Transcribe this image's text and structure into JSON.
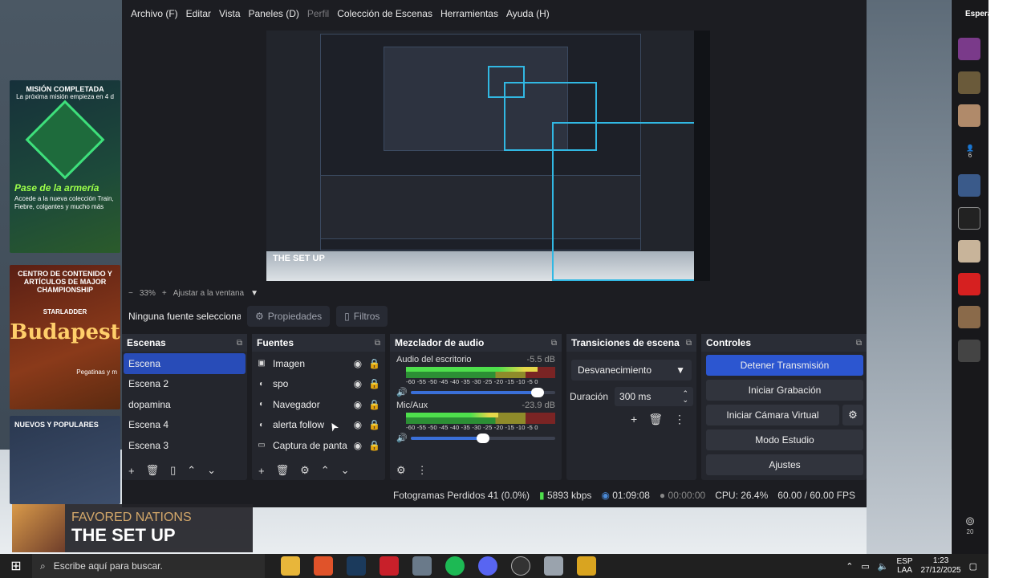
{
  "background": {
    "card1": {
      "title": "MISIÓN COMPLETADA",
      "subtitle": "La próxima misión empieza en 4 d",
      "headline": "Pase de la armería",
      "text": "Accede a la nueva colección Train, Fiebre, colgantes y mucho más"
    },
    "card2": {
      "title": "CENTRO DE CONTENIDO Y ARTÍCULOS DE MAJOR CHAMPIONSHIP",
      "brand": "STARLADDER",
      "headline": "Budapest",
      "note": "Pegatinas y m"
    },
    "card3": {
      "title": "NUEVOS Y POPULARES"
    }
  },
  "sidebar": {
    "title": "Espera",
    "viewers": "6",
    "podcast": "20"
  },
  "menu": [
    {
      "label": "Archivo (F)",
      "disabled": false
    },
    {
      "label": "Editar",
      "disabled": false
    },
    {
      "label": "Vista",
      "disabled": false
    },
    {
      "label": "Paneles (D)",
      "disabled": false
    },
    {
      "label": "Perfil",
      "disabled": true
    },
    {
      "label": "Colección de Escenas",
      "disabled": false
    },
    {
      "label": "Herramientas",
      "disabled": false
    },
    {
      "label": "Ayuda (H)",
      "disabled": false
    }
  ],
  "preview": {
    "inner_song": "THE SET UP"
  },
  "zoom": {
    "minus": "−",
    "level": "33%",
    "plus": "+",
    "fit_label": "Ajustar a la ventana",
    "arrow": "▼"
  },
  "source_toolbar": {
    "no_source": "Ninguna fuente seleccionac",
    "properties": "Propiedades",
    "filters": "Filtros"
  },
  "scenes": {
    "title": "Escenas",
    "items": [
      "Escena",
      "Escena 2",
      "dopamina",
      "Escena 4",
      "Escena 3"
    ],
    "selected": 0
  },
  "sources": {
    "title": "Fuentes",
    "items": [
      {
        "label": "Imagen",
        "icon": "image-icon"
      },
      {
        "label": "spo",
        "icon": "globe-icon"
      },
      {
        "label": "Navegador",
        "icon": "globe-icon"
      },
      {
        "label": "alerta follow",
        "icon": "globe-icon"
      },
      {
        "label": "Captura de panta",
        "icon": "monitor-icon"
      }
    ]
  },
  "mixer": {
    "title": "Mezclador de audio",
    "ticks": "-60 -55 -50 -45 -40 -35 -30 -25 -20 -15 -10 -5 0",
    "channels": [
      {
        "name": "Audio del escritorio",
        "db": "-5.5 dB",
        "level": 0.88,
        "volume": 0.88
      },
      {
        "name": "Mic/Aux",
        "db": "-23.9 dB",
        "level": 0.62,
        "volume": 0.5
      }
    ]
  },
  "transitions": {
    "title": "Transiciones de escena",
    "selected": "Desvanecimiento",
    "duration_label": "Duración",
    "duration_value": "300 ms"
  },
  "controls": {
    "title": "Controles",
    "stop_stream": "Detener Transmisión",
    "start_record": "Iniciar Grabación",
    "start_vcam": "Iniciar Cámara Virtual",
    "studio_mode": "Modo Estudio",
    "settings": "Ajustes"
  },
  "status": {
    "dropped": "Fotogramas Perdidos 41 (0.0%)",
    "bitrate": "5893 kbps",
    "stream_time": "01:09:08",
    "rec_time": "00:00:00",
    "cpu": "CPU: 26.4%",
    "fps": "60.00 / 60.00 FPS"
  },
  "overlay": {
    "band": "FAVORED NATIONS",
    "song": "THE SET UP"
  },
  "taskbar": {
    "search_placeholder": "Escribe aquí para buscar.",
    "lang": "ESP",
    "lang2": "LAA",
    "time": "1:23",
    "date": "27/12/2025"
  },
  "colors": {
    "accent": "#284cb8",
    "primary_button": "#2c56d0",
    "preview_outline": "#31b8e3"
  }
}
